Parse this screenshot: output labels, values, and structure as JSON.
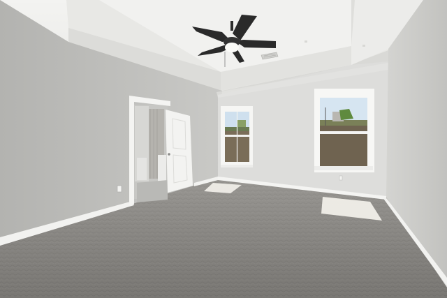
{
  "scene": {
    "kind": "empty-bedroom-interior",
    "objects": [
      "tray-ceiling",
      "ceiling-fan",
      "ceiling-vent",
      "doorway",
      "open-door",
      "window-center",
      "window-right",
      "carpet",
      "baseboard",
      "outlet",
      "sunlight-patch"
    ],
    "colors": {
      "ceiling": "#efefed",
      "tray_face": "#e4e4e1",
      "left_wall": "#bdbdba",
      "back_wall": "#dddddb",
      "right_wall": "#cfcfcc",
      "carpet": "#8e8c88",
      "trim": "#f5f5f3",
      "fan": "#2c2c2c",
      "light": "#fbfbf8",
      "sky": "#cfe0ee",
      "ground": "#6f6350"
    }
  }
}
